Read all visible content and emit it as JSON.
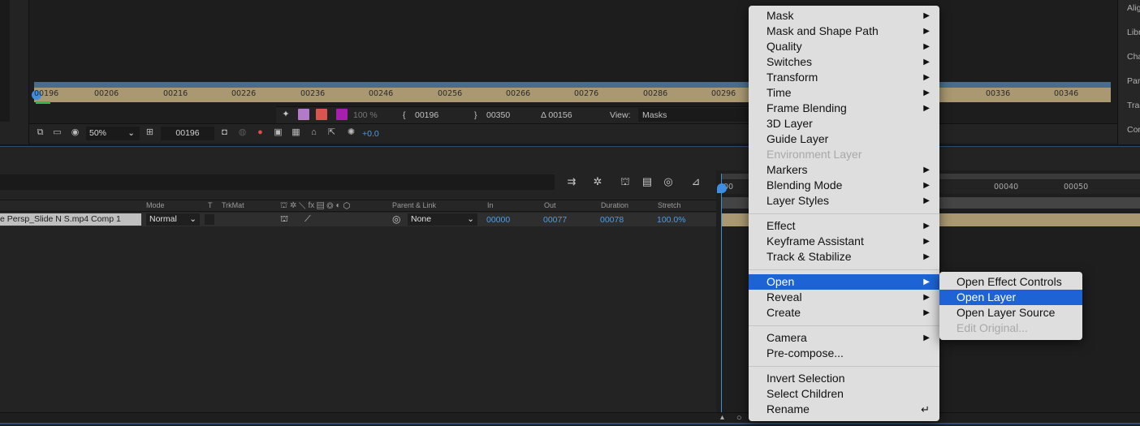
{
  "viewer": {
    "ruler_ticks": [
      "00196",
      "00206",
      "00216",
      "00226",
      "00236",
      "00246",
      "00256",
      "00266",
      "00276",
      "00286",
      "00296",
      "00336",
      "00346"
    ],
    "info": {
      "opacity": "100 %",
      "in_point": "00196",
      "out_point": "00350",
      "duration": "Δ 00156",
      "view_label": "View:",
      "view_value": "Masks"
    },
    "toolbar": {
      "zoom": "50%",
      "current_frame": "00196",
      "exposure": "+0.0"
    }
  },
  "right_panel": {
    "items": [
      "Alig",
      "Libr",
      "Cha",
      "Par",
      "Trac",
      "Con"
    ]
  },
  "timeline": {
    "columns": {
      "mode": "Mode",
      "t": "T",
      "trkmat": "TrkMat",
      "parent": "Parent & Link",
      "in": "In",
      "out": "Out",
      "duration": "Duration",
      "stretch": "Stretch"
    },
    "layer": {
      "name": "e Persp_Slide N S.mp4 Comp 1",
      "mode": "Normal",
      "parent": "None",
      "in": "00000",
      "out": "00077",
      "duration": "00078",
      "stretch": "100.0%"
    },
    "ruler_ticks": [
      "00",
      "00040",
      "00050"
    ]
  },
  "context_menu": {
    "items": [
      {
        "label": "Mask",
        "submenu": true
      },
      {
        "label": "Mask and Shape Path",
        "submenu": true
      },
      {
        "label": "Quality",
        "submenu": true
      },
      {
        "label": "Switches",
        "submenu": true
      },
      {
        "label": "Transform",
        "submenu": true
      },
      {
        "label": "Time",
        "submenu": true
      },
      {
        "label": "Frame Blending",
        "submenu": true
      },
      {
        "label": "3D Layer"
      },
      {
        "label": "Guide Layer"
      },
      {
        "label": "Environment Layer",
        "disabled": true
      },
      {
        "label": "Markers",
        "submenu": true
      },
      {
        "label": "Blending Mode",
        "submenu": true
      },
      {
        "label": "Layer Styles",
        "submenu": true
      },
      {
        "label": "Effect",
        "submenu": true
      },
      {
        "label": "Keyframe Assistant",
        "submenu": true
      },
      {
        "label": "Track & Stabilize",
        "submenu": true
      },
      {
        "label": "Open",
        "submenu": true,
        "highlighted": true
      },
      {
        "label": "Reveal",
        "submenu": true
      },
      {
        "label": "Create",
        "submenu": true
      },
      {
        "label": "Camera",
        "submenu": true
      },
      {
        "label": "Pre-compose..."
      },
      {
        "label": "Invert Selection"
      },
      {
        "label": "Select Children"
      },
      {
        "label": "Rename",
        "shortcut": "↵"
      }
    ],
    "submenu_open": {
      "items": [
        {
          "label": "Open Effect Controls"
        },
        {
          "label": "Open Layer",
          "highlighted": true
        },
        {
          "label": "Open Layer Source"
        },
        {
          "label": "Edit Original...",
          "disabled": true
        }
      ]
    }
  },
  "colors": {
    "accent_blue": "#1d63d6",
    "timecode_blue": "#4c9de8",
    "layer_bar": "#a99872"
  }
}
